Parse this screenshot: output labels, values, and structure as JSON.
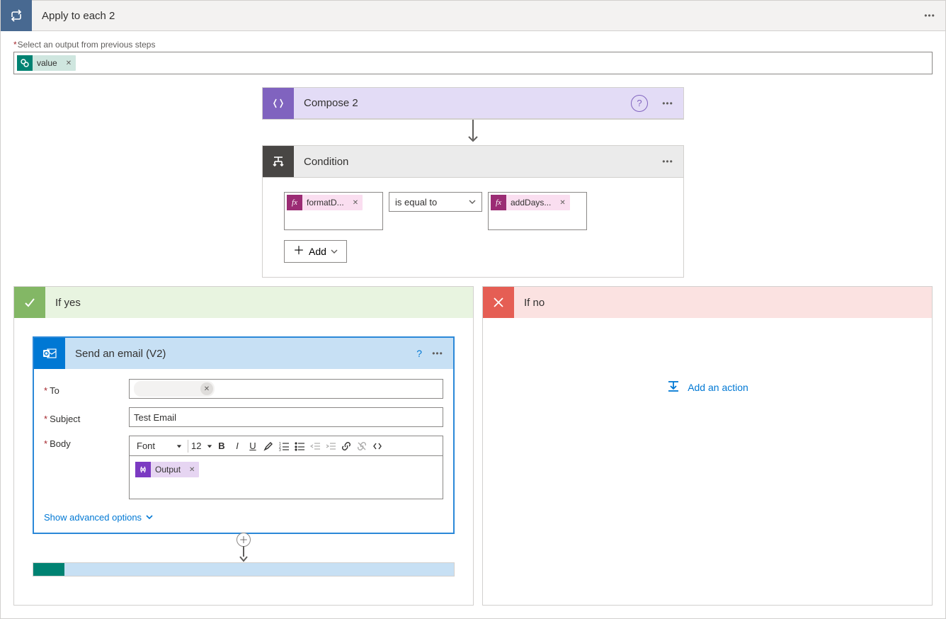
{
  "header": {
    "title": "Apply to each 2"
  },
  "output_select": {
    "label": "Select an output from previous steps",
    "token": "value"
  },
  "compose": {
    "title": "Compose 2"
  },
  "condition": {
    "title": "Condition",
    "left_token": "formatD...",
    "operator": "is equal to",
    "right_token": "addDays...",
    "add_btn": "Add"
  },
  "yes_branch": {
    "title": "If yes"
  },
  "no_branch": {
    "title": "If no",
    "add_action": "Add an action"
  },
  "email": {
    "title": "Send an email (V2)",
    "to_label": "To",
    "subject_label": "Subject",
    "subject_value": "Test Email",
    "body_label": "Body",
    "body_token": "Output",
    "advanced": "Show advanced options",
    "toolbar": {
      "font_label": "Font",
      "size_label": "12"
    }
  }
}
